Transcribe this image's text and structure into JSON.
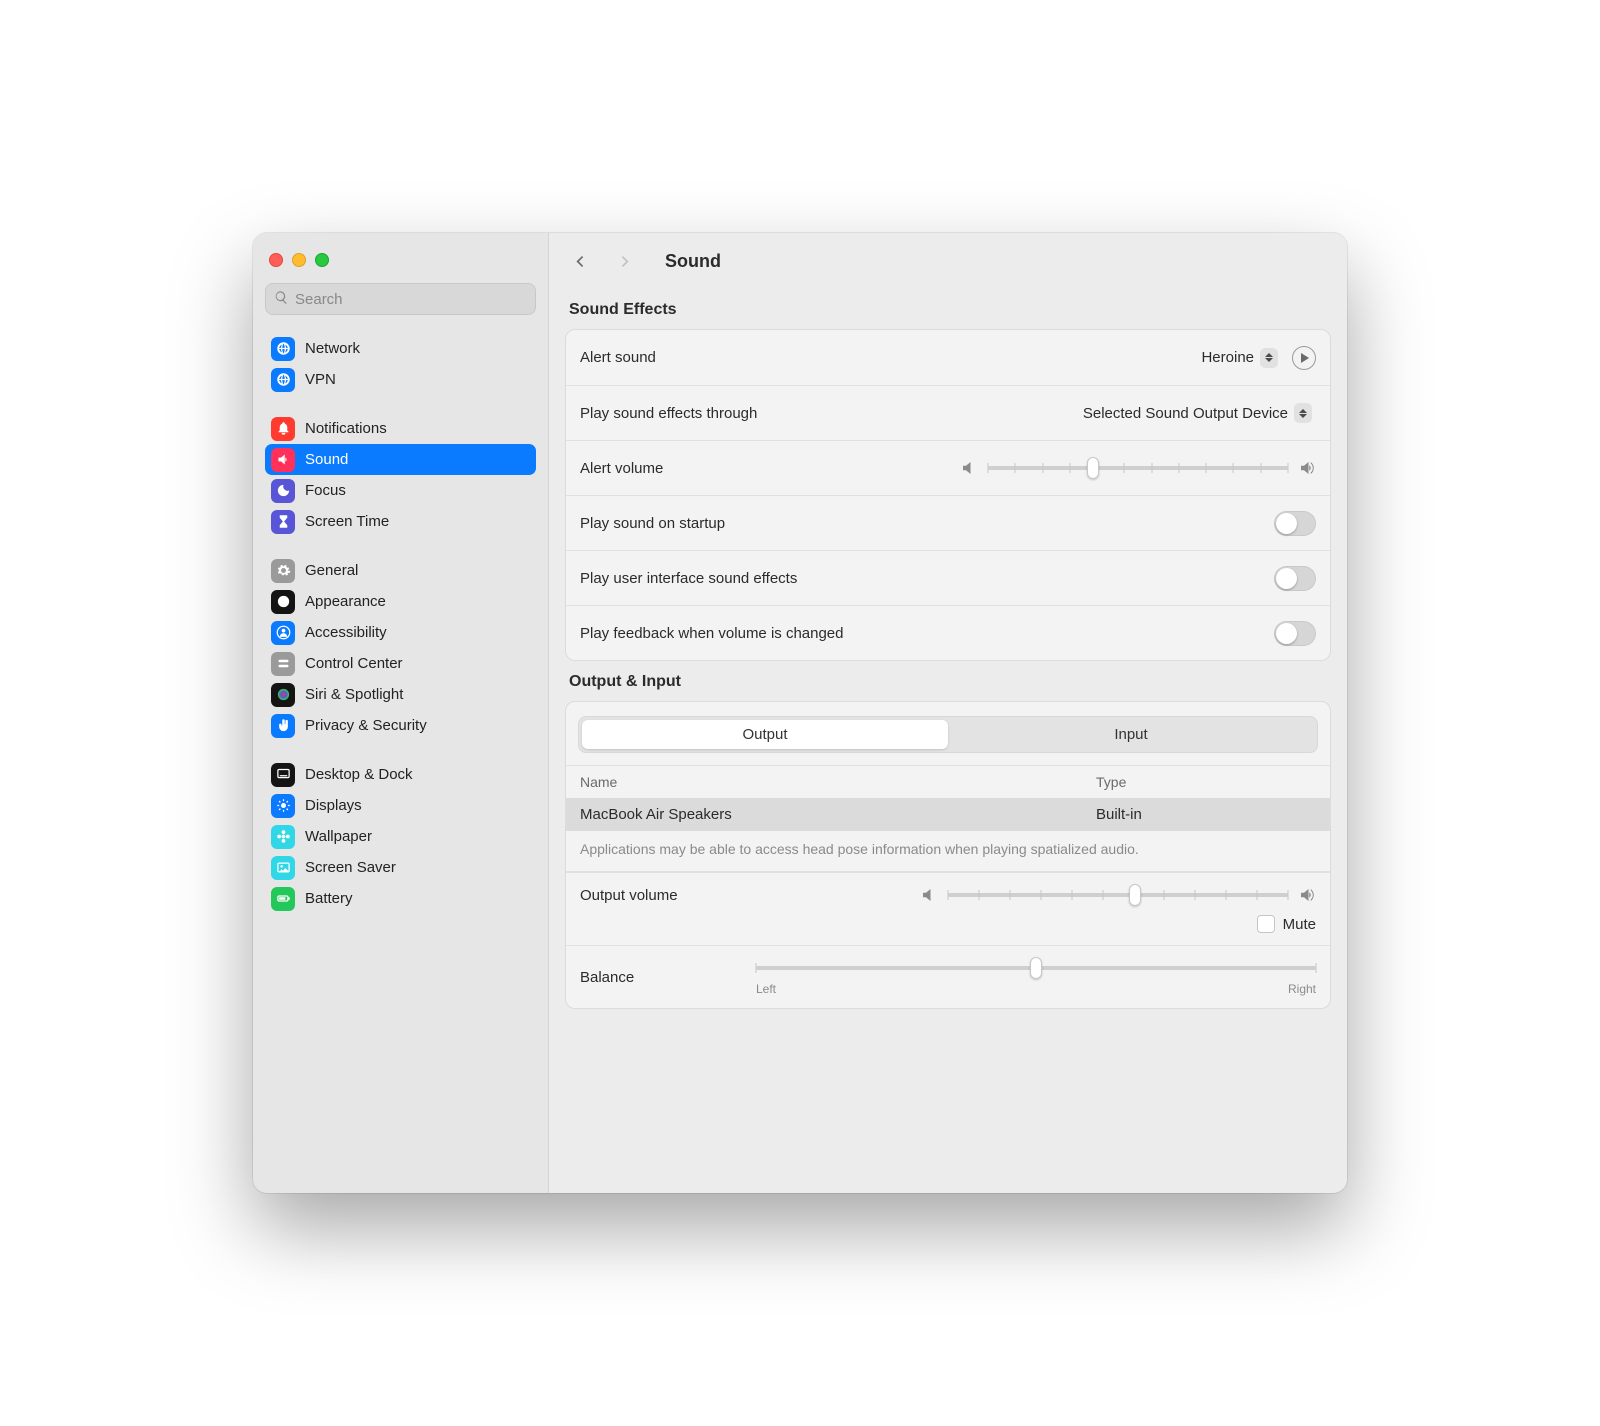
{
  "window": {
    "title": "Sound"
  },
  "search": {
    "placeholder": "Search"
  },
  "sidebar_groups": [
    {
      "items": [
        {
          "label": "Network",
          "icon": "globe",
          "color": "#0a7aff"
        },
        {
          "label": "VPN",
          "icon": "globe",
          "color": "#0a7aff"
        }
      ]
    },
    {
      "items": [
        {
          "label": "Notifications",
          "icon": "bell",
          "color": "#ff3b30"
        },
        {
          "label": "Sound",
          "icon": "speaker",
          "color": "#ff3059",
          "selected": true
        },
        {
          "label": "Focus",
          "icon": "moon",
          "color": "#5856d6"
        },
        {
          "label": "Screen Time",
          "icon": "hourglass",
          "color": "#5856d6"
        }
      ]
    },
    {
      "items": [
        {
          "label": "General",
          "icon": "gear",
          "color": "#9a9a9a"
        },
        {
          "label": "Appearance",
          "icon": "appearance",
          "color": "#141414"
        },
        {
          "label": "Accessibility",
          "icon": "person",
          "color": "#0a7aff"
        },
        {
          "label": "Control Center",
          "icon": "switches",
          "color": "#9a9a9a"
        },
        {
          "label": "Siri & Spotlight",
          "icon": "siri",
          "color": "#141414"
        },
        {
          "label": "Privacy & Security",
          "icon": "hand",
          "color": "#0a7aff"
        }
      ]
    },
    {
      "items": [
        {
          "label": "Desktop & Dock",
          "icon": "dock",
          "color": "#141414"
        },
        {
          "label": "Displays",
          "icon": "sun",
          "color": "#0a7aff"
        },
        {
          "label": "Wallpaper",
          "icon": "flower",
          "color": "#2fd7e7"
        },
        {
          "label": "Screen Saver",
          "icon": "photo",
          "color": "#2fd7e7"
        },
        {
          "label": "Battery",
          "icon": "battery",
          "color": "#24c759"
        }
      ]
    }
  ],
  "sound_effects": {
    "header": "Sound Effects",
    "alert_sound": {
      "label": "Alert sound",
      "value": "Heroine"
    },
    "play_through": {
      "label": "Play sound effects through",
      "value": "Selected Sound Output Device"
    },
    "alert_volume": {
      "label": "Alert volume",
      "value_pct": 35
    },
    "startup": {
      "label": "Play sound on startup",
      "on": false
    },
    "ui_sounds": {
      "label": "Play user interface sound effects",
      "on": false
    },
    "volume_feedback": {
      "label": "Play feedback when volume is changed",
      "on": false
    }
  },
  "output_input": {
    "header": "Output & Input",
    "tabs": {
      "output": "Output",
      "input": "Input",
      "active": "output"
    },
    "columns": {
      "name": "Name",
      "type": "Type"
    },
    "rows": [
      {
        "name": "MacBook Air Speakers",
        "type": "Built-in"
      }
    ],
    "note": "Applications may be able to access head pose information when playing spatialized audio.",
    "output_volume": {
      "label": "Output volume",
      "value_pct": 55
    },
    "mute": {
      "label": "Mute",
      "checked": false
    },
    "balance": {
      "label": "Balance",
      "value_pct": 50,
      "left": "Left",
      "right": "Right"
    }
  }
}
